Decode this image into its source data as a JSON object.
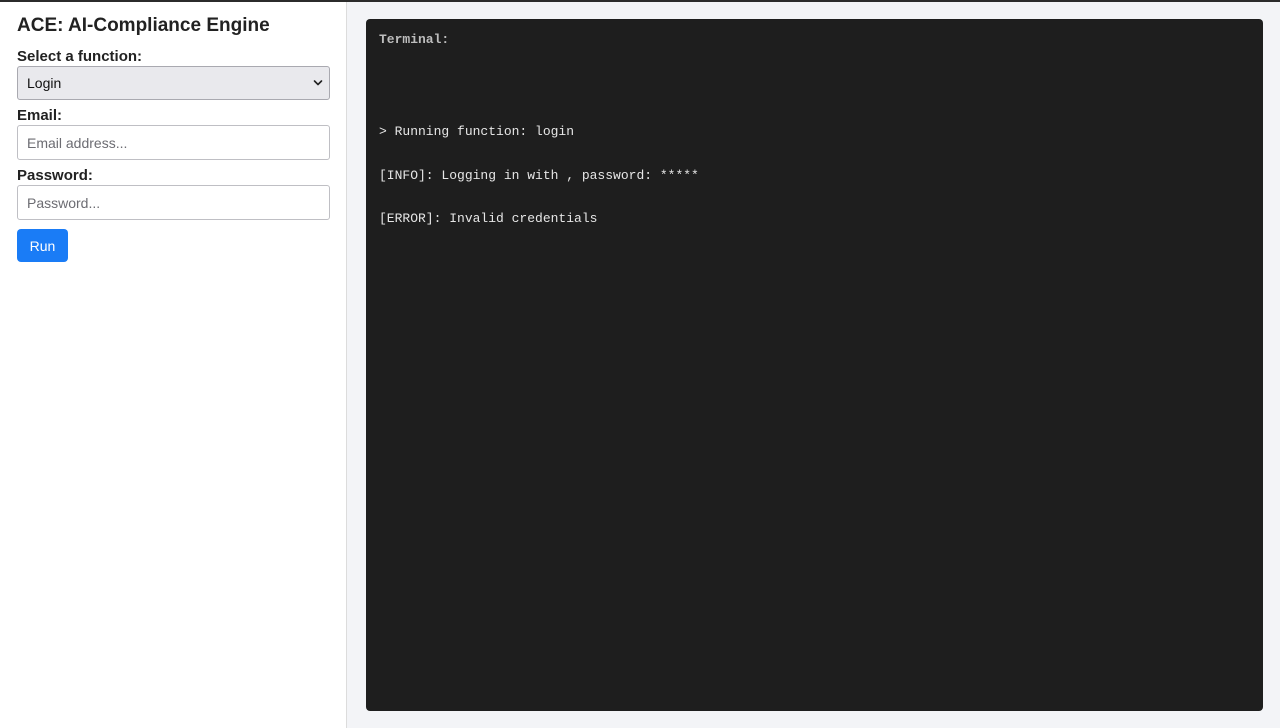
{
  "app": {
    "title": "ACE: AI-Compliance Engine"
  },
  "form": {
    "function_label": "Select a function:",
    "function_selected": "Login",
    "email_label": "Email:",
    "email_placeholder": "Email address...",
    "email_value": "",
    "password_label": "Password:",
    "password_placeholder": "Password...",
    "password_value": "",
    "run_label": "Run"
  },
  "terminal": {
    "title": "Terminal:",
    "lines": [
      "> Running function: login",
      "[INFO]: Logging in with , password: *****",
      "[ERROR]: Invalid credentials"
    ]
  },
  "icons": {
    "select_arrow": "chevron-down-icon"
  },
  "colors": {
    "accent": "#1a7cf6",
    "terminal_bg": "#1e1e1e",
    "page_bg": "#f3f4f7"
  }
}
